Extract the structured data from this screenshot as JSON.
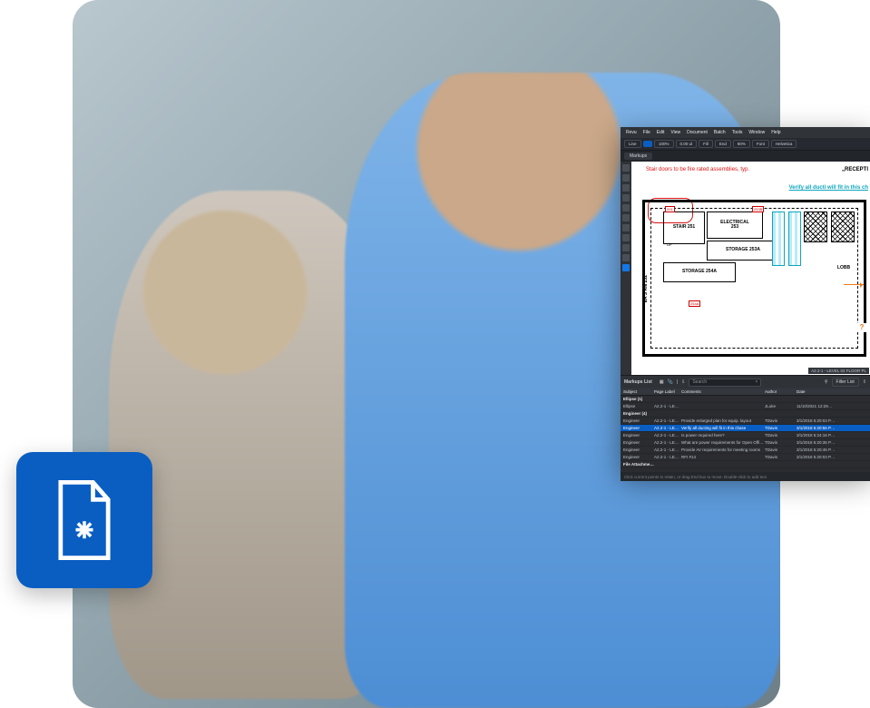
{
  "menu": [
    "Revu",
    "File",
    "Edit",
    "View",
    "Document",
    "Batch",
    "Tools",
    "Window",
    "Help"
  ],
  "toolbar": {
    "line_tool": "Line",
    "zoom_pct": "100%",
    "fill_label": "Fill",
    "end_label": "End",
    "opacity_label": "80%",
    "font_label": "Font",
    "font_value": "Helvetica",
    "coord": "0.00 ul"
  },
  "tab1": "Markups",
  "leftrail_count": 11,
  "canvas": {
    "red_annotation": "Stair doors to be fire\nrated assemblies, typ.",
    "cyan_annotation": "Verify all ducti\nwill fit in this ch",
    "reception": "„RECEPTI",
    "rooms": {
      "stair": "STAIR 251",
      "up": "UP",
      "electrical": "ELECTRICAL\n253",
      "storage_a": "STORAGE 253A",
      "storage_b": "STORAGE 254A",
      "lobby": "LOBB",
      "ers": "ER'S RM 252"
    },
    "dims": {
      "d1": "201",
      "d2": "253B",
      "d3": "254A"
    },
    "page_footer": "A2.2-1 - LEVEL 02 FLOOR PL",
    "qmark": "?"
  },
  "panel": {
    "title": "Markups List",
    "search_placeholder": "Search",
    "filter_label": "Filter List",
    "columns": [
      "Subject",
      "Page Label",
      "Comments",
      "Author",
      "Date"
    ],
    "groups": {
      "ellipse": "Ellipse (1)",
      "engineer": "Engineer (4)",
      "file": "File Attachment (1)"
    },
    "rows": [
      {
        "subject": "Ellipse",
        "page": "A2.2-1 - LEVE…",
        "comments": "",
        "author": "JLuke",
        "date": "11/10/2021 12:29…"
      },
      {
        "subject": "Engineer",
        "page": "A2.2-1 - LEVE…",
        "comments": "Provide enlarged plan for equip. layout",
        "author": "TDavis",
        "date": "3/1/2018 5:20:03 P…"
      },
      {
        "subject": "Engineer",
        "page": "A2.2-1 - LEVE…",
        "comments": "Verify all ducting will fit in this chase",
        "author": "TDavis",
        "date": "3/1/2018 5:20:56 P…",
        "selected": true
      },
      {
        "subject": "Engineer",
        "page": "A2.2-1 - LEVE…",
        "comments": "Is power required here?",
        "author": "TDavis",
        "date": "3/1/2018 5:24:16 P…"
      },
      {
        "subject": "Engineer",
        "page": "A2.2-1 - LEVE…",
        "comments": "What are power requirements for Open Office areas?",
        "author": "TDavis",
        "date": "3/1/2018 5:20:35 P…"
      },
      {
        "subject": "Engineer",
        "page": "A2.2-1 - LEVE…",
        "comments": "Provide AV requirements for meeting rooms",
        "author": "TDavis",
        "date": "3/1/2018 5:20:46 P…"
      },
      {
        "subject": "Engineer",
        "page": "A2.2-1 - LEVE…",
        "comments": "RFI #14",
        "author": "TDavis",
        "date": "3/1/2018 5:20:03 P…"
      }
    ]
  },
  "statusbar": "Click current points to retain, or drag End box to move. Double-click to add text"
}
